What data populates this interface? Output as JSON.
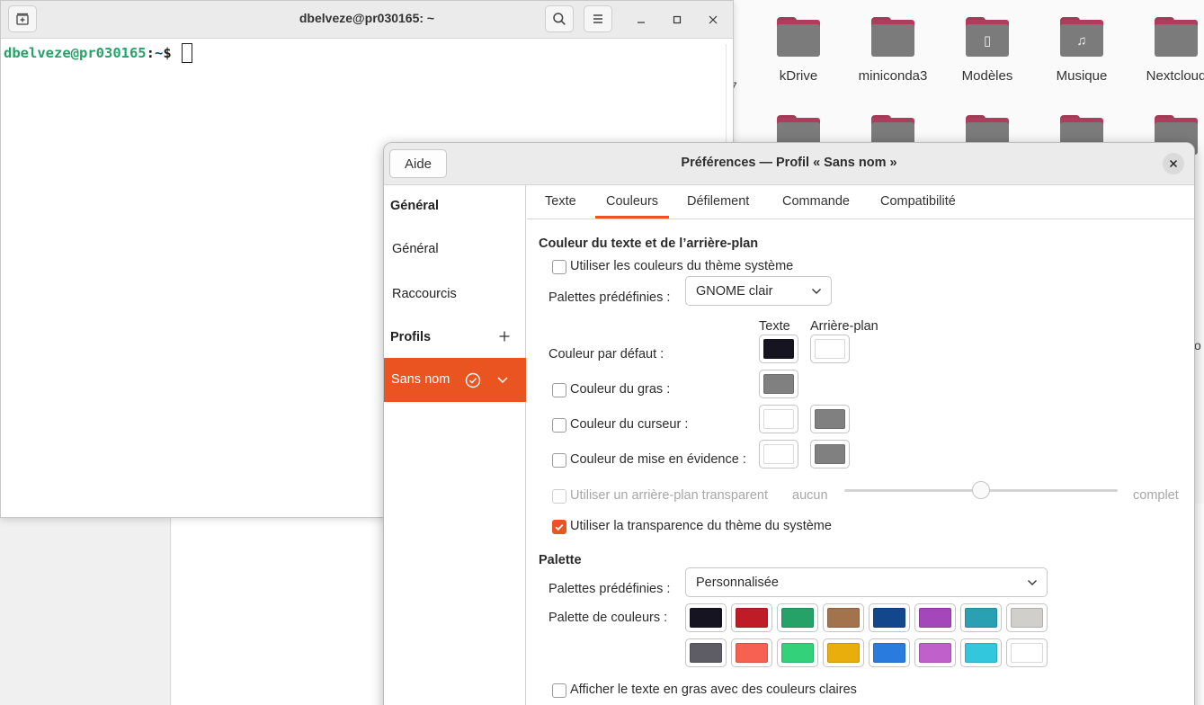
{
  "file_manager": {
    "folders_row1": [
      {
        "label": "kDrive",
        "icon": "folder-icon",
        "glyph": ""
      },
      {
        "label": "miniconda3",
        "icon": "folder-icon",
        "glyph": ""
      },
      {
        "label": "Modèles",
        "icon": "templates-folder-icon",
        "glyph": "▯"
      },
      {
        "label": "Musique",
        "icon": "music-folder-icon",
        "glyph": "♫"
      },
      {
        "label": "Nextcloud",
        "icon": "folder-icon",
        "glyph": ""
      }
    ],
    "fragment_left": "7",
    "fragment_right": "o"
  },
  "terminal": {
    "title": "dbelveze@pr030165: ~",
    "prompt_user": "dbelveze@pr030165",
    "prompt_sep": ":",
    "prompt_path": "~",
    "prompt_end": "$ "
  },
  "prefs": {
    "help_label": "Aide",
    "title": "Préférences — Profil « Sans nom »",
    "sidebar": {
      "general_header": "Général",
      "general_item": "Général",
      "shortcuts_item": "Raccourcis",
      "profiles_header": "Profils",
      "profile_name": "Sans nom"
    },
    "tabs": [
      "Texte",
      "Couleurs",
      "Défilement",
      "Commande",
      "Compatibilité"
    ],
    "active_tab": "Couleurs",
    "colors": {
      "section_title": "Couleur du texte et de l’arrière-plan",
      "use_system_theme": "Utiliser les couleurs du thème système",
      "presets_label": "Palettes prédéfinies :",
      "presets_value": "GNOME clair",
      "col_text": "Texte",
      "col_bg": "Arrière-plan",
      "default_color": "Couleur par défaut :",
      "bold_color": "Couleur du gras :",
      "cursor_color": "Couleur du curseur :",
      "highlight_color": "Couleur de mise en évidence :",
      "transparent_bg": "Utiliser un arrière-plan transparent",
      "transparent_min": "aucun",
      "transparent_max": "complet",
      "transparent_level": 0.5,
      "system_transparency": "Utiliser la transparence du thème du système",
      "swatches": {
        "default_text": "#171421",
        "default_bg": "#ffffff",
        "bold": "#808080",
        "cursor_text": "#ffffff",
        "cursor_bg": "#808080",
        "highlight_text": "#ffffff",
        "highlight_bg": "#808080"
      }
    },
    "palette": {
      "section_title": "Palette",
      "presets_label": "Palettes prédéfinies :",
      "presets_value": "Personnalisée",
      "palette_label": "Palette de couleurs :",
      "row1": [
        "#171421",
        "#c01c28",
        "#26a269",
        "#a2734c",
        "#12488b",
        "#a347ba",
        "#2aa1b3",
        "#d0cfcc"
      ],
      "row2": [
        "#5e5c64",
        "#f66151",
        "#33d17a",
        "#e9ad0c",
        "#2a7bde",
        "#c061cb",
        "#33c7de",
        "#ffffff"
      ],
      "bold_bright": "Afficher le texte en gras avec des couleurs claires"
    }
  }
}
